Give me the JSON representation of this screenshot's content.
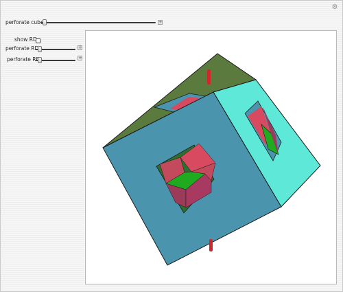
{
  "controls": {
    "perforate_cube": {
      "label": "perforate cube",
      "value": 0.02
    },
    "show_rd": {
      "label": "show RD",
      "checked": false
    },
    "perforate_rd": {
      "label": "perforate RD",
      "value": 0.05
    },
    "perforate_re": {
      "label": "perforate RE",
      "value": 0.05
    }
  },
  "icons": {
    "settings": "gear-icon",
    "expand": "plus-icon"
  },
  "colors": {
    "cube_front": "#4a94ad",
    "cube_right": "#5ee8d8",
    "cube_top": "#5a7a3e",
    "inner_red": "#d84a60",
    "inner_green": "#1faa1f",
    "inner_maroon": "#9c3a5a",
    "axis_rod": "#d02828"
  }
}
